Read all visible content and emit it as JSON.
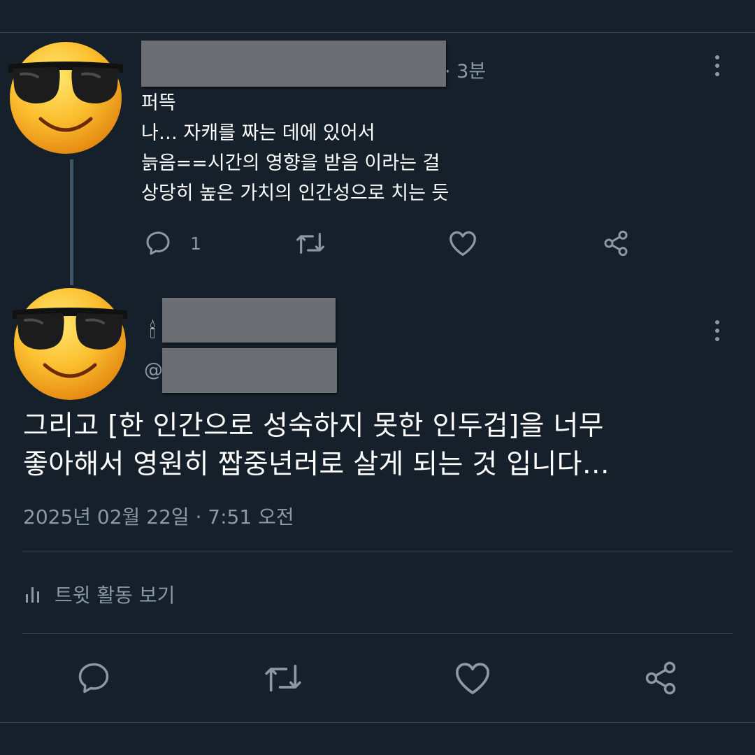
{
  "reply": {
    "time": "· 3분",
    "lines": [
      "퍼뜩",
      "나… 자캐를 짜는 데에 있어서",
      "늙음==시간의 영향을 받음 이라는 걸",
      "상당히 높은 가치의 인간성으로 치는 듯"
    ],
    "reply_count": "1"
  },
  "main": {
    "display_name_emoji": "🕯",
    "handle_prefix": "@",
    "lines": [
      "그리고 [한 인간으로 성숙하지 못한 인두겁]을 너무",
      "좋아해서 영원히 짭중년러로 살게 되는 것 입니다…"
    ],
    "timestamp": "2025년 02월 22일 · 7:51 오전",
    "activity_label": "트윗 활동 보기"
  },
  "icons": {
    "reply": "reply-icon",
    "retweet": "retweet-icon",
    "like": "like-icon",
    "share": "share-icon",
    "more": "more-icon",
    "activity": "activity-icon",
    "avatar": "sunglasses-emoji-avatar"
  },
  "colors": {
    "background": "#15202b",
    "muted": "#8b98a5",
    "divider": "#38444d"
  }
}
